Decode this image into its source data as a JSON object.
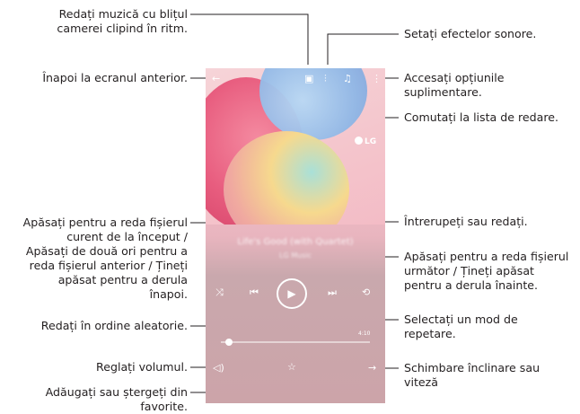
{
  "callouts": {
    "flash": "Redați muzică cu blițul\ncamerei clipind în ritm.",
    "back": "Înapoi la ecranul anterior.",
    "sound_effects": "Setați efectelor sonore.",
    "more_options": "Accesați opțiunile\nsuplimentare.",
    "playlist": "Comutați la lista de redare.",
    "previous": "Apăsați pentru a reda fișierul\ncurent de la început /\nApăsați de două ori pentru a\nreda fișierul anterior / Țineți\napăsat pentru a derula\nînapoi.",
    "pause_play": "Întrerupeți sau redați.",
    "next": "Apăsați pentru a reda fișierul\nurmător / Țineți apăsat\npentru a derula înainte.",
    "shuffle": "Redați în ordine aleatorie.",
    "repeat": "Selectați un mod de\nrepetare.",
    "volume": "Reglați volumul.",
    "speed": "Schimbare înclinare sau\nviteză",
    "favorite": "Adăugați sau ștergeți din\nfavorite."
  },
  "player": {
    "logo": "LG",
    "song_title": "Life's Good (with Quartet)",
    "artist": "LG Music",
    "total_time": "4:10"
  },
  "icons": [
    "back-icon",
    "flash-icon",
    "equalizer-icon",
    "playlist-icon",
    "more-icon",
    "shuffle-icon",
    "previous-icon",
    "play-icon",
    "next-icon",
    "repeat-icon",
    "volume-icon",
    "favorite-icon",
    "speed-icon"
  ]
}
